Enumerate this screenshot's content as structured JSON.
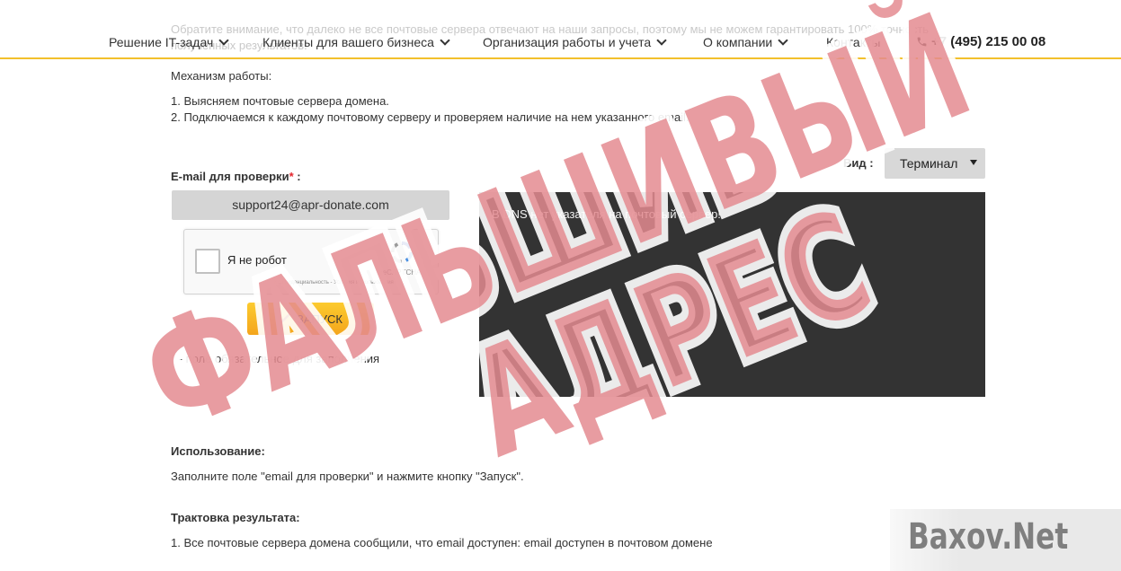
{
  "nav": {
    "items": [
      {
        "label": "Решение IT-задач"
      },
      {
        "label": "Клиенты для вашего бизнеса"
      },
      {
        "label": "Организация работы и учета"
      },
      {
        "label": "О компании"
      },
      {
        "label": "Контакты"
      }
    ],
    "phone": "+7 (495) 215 00 08"
  },
  "ghost_text": "Обратите внимание, что далеко не все почтовые сервера отвечают на наши запросы, поэтому мы не можем гарантировать 100% точность полученных результатов.",
  "mechanism": {
    "title": "Механизм работы:",
    "steps": [
      "1. Выясняем почтовые сервера домена.",
      "2. Подключаемся к каждому почтовому серверу и проверяем наличие на нем указанного email."
    ]
  },
  "form": {
    "email_label": "E-mail для проверки",
    "required_mark": "*",
    "email_label_suffix": " :",
    "email_value": "support24@apr-donate.com",
    "captcha": {
      "label": "Я не робот",
      "brand": "reCAPTCHA",
      "terms": "Конфиденциальность - Условия использования"
    },
    "launch_label": "ЗАПУСК",
    "required_note": " - поле обязательное для заполнения"
  },
  "view": {
    "label": "Вид :",
    "selected": "Терминал"
  },
  "terminal": {
    "output": "В DNS нет указателя на почтовый сервер!"
  },
  "usage": {
    "title": "Использование:",
    "text": "Заполните поле \"email для проверки\" и нажмите кнопку \"Запуск\"."
  },
  "interpretation": {
    "title": "Трактовка результата:",
    "line1": "1. Все почтовые сервера домена сообщили, что email доступен: email доступен в почтовом домене"
  },
  "stamp": {
    "line1": "ФАЛЬШИВЫЙ",
    "line2": "АДРЕС"
  },
  "watermark": "Baxov.Net",
  "colors": {
    "accent": "#f2c02c",
    "button": "#f4a51c",
    "terminal_bg": "#333333",
    "stamp": "#d9545b"
  }
}
